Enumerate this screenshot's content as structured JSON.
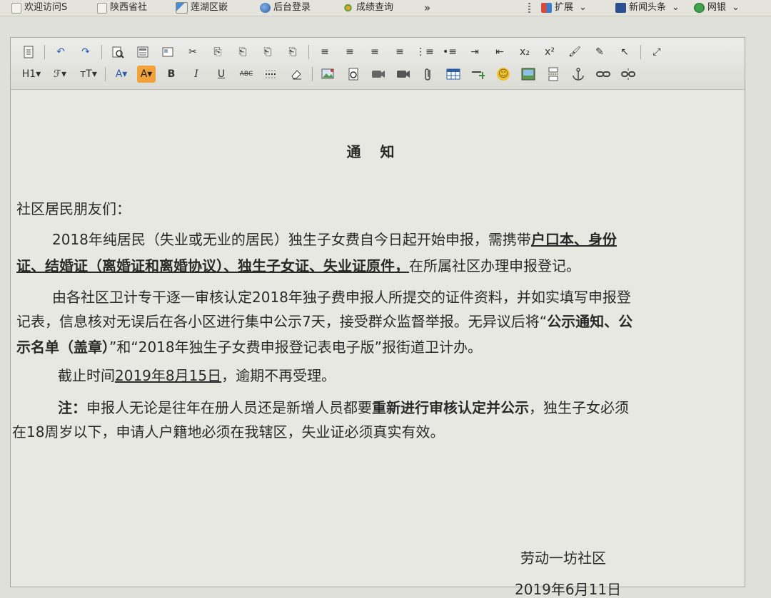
{
  "bookmarks_bar": {
    "items": [
      {
        "label": "欢迎访问S",
        "icon": "page-icon"
      },
      {
        "label": "陕西省社",
        "icon": "page-icon"
      },
      {
        "label": "莲湖区嵌",
        "icon": "chart-icon"
      },
      {
        "label": "后台登录",
        "icon": "globe-icon"
      },
      {
        "label": "成绩查询",
        "icon": "pinwheel-icon"
      }
    ],
    "more": "»",
    "right": [
      {
        "label": "扩展",
        "icon": "extensions-icon",
        "dropdown": "⌄"
      },
      {
        "label": "新闻头条",
        "icon": "news-icon",
        "dropdown": "⌄"
      },
      {
        "label": "网银",
        "icon": "bank-icon",
        "dropdown": "⌄"
      }
    ]
  },
  "toolbar": {
    "row1": [
      "↶",
      "↷",
      "Aa",
      "Aa",
      "✂",
      "⎘",
      "⎗",
      "⎗",
      "⎗",
      "≡",
      "≡",
      "≡",
      "≡",
      "⋮≡",
      "•≡",
      "⇥",
      "⇤",
      "x₂",
      "x²",
      "🖌",
      "✎",
      "↖",
      "⤢"
    ],
    "row2": {
      "heading": "H1▾",
      "font_family": "ℱ▾",
      "font_size": "тT▾",
      "font_color": "A▾",
      "highlight": "A▾",
      "bold": "B",
      "italic": "I",
      "underline": "U",
      "strike": "ABC",
      "emoji": "☺"
    }
  },
  "document": {
    "title": "通  知",
    "greeting": "社区居民朋友们：",
    "p1": {
      "l1_a": "2018年纯居民（失业或无业的居民）独生子女费自今日起开始申报，需携带",
      "l1_b": "户口本、身份",
      "l2_a": "证、结婚证（离婚证和离婚协议）、独生子女证、失业证原件，",
      "l2_b": "在所属社区办理申报登记。"
    },
    "p2": {
      "l1": "由各社区卫计专干逐一审核认定2018年独子费申报人所提交的证件资料，并如实填写申报登",
      "l2_a": "记表，信息核对无误后在各小区进行集中公示7天，接受群众监督举报。无异议后将“",
      "l2_b": "公示通知、公",
      "l3_a": "示名单（盖章）",
      "l3_b": "”和“2018年独生子女费申报登记表电子版”报街道卫计办。"
    },
    "deadline": {
      "prefix": "截止时间",
      "date": "2019年8月15日",
      "suffix": "，逾期不再受理。"
    },
    "note": {
      "label": "注：",
      "l1_a": "申报人无论是往年在册人员还是新增人员都要",
      "l1_b": "重新进行审核认定并公示",
      "l1_c": "，独生子女必须",
      "l2": "在18周岁以下，申请人户籍地必须在我辖区，失业证必须真实有效。"
    },
    "signature": "劳动一坊社区",
    "date": "2019年6月11日"
  }
}
